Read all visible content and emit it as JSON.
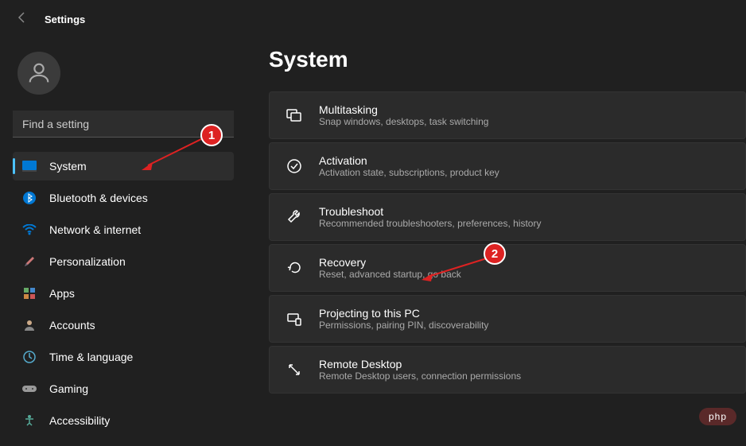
{
  "header": {
    "title": "Settings"
  },
  "search": {
    "placeholder": "Find a setting"
  },
  "sidebar": {
    "items": [
      {
        "label": "System"
      },
      {
        "label": "Bluetooth & devices"
      },
      {
        "label": "Network & internet"
      },
      {
        "label": "Personalization"
      },
      {
        "label": "Apps"
      },
      {
        "label": "Accounts"
      },
      {
        "label": "Time & language"
      },
      {
        "label": "Gaming"
      },
      {
        "label": "Accessibility"
      }
    ]
  },
  "page": {
    "title": "System"
  },
  "cards": [
    {
      "title": "Multitasking",
      "sub": "Snap windows, desktops, task switching"
    },
    {
      "title": "Activation",
      "sub": "Activation state, subscriptions, product key"
    },
    {
      "title": "Troubleshoot",
      "sub": "Recommended troubleshooters, preferences, history"
    },
    {
      "title": "Recovery",
      "sub": "Reset, advanced startup, go back"
    },
    {
      "title": "Projecting to this PC",
      "sub": "Permissions, pairing PIN, discoverability"
    },
    {
      "title": "Remote Desktop",
      "sub": "Remote Desktop users, connection permissions"
    }
  ],
  "annotations": {
    "badge1": "1",
    "badge2": "2"
  },
  "watermark": "php"
}
